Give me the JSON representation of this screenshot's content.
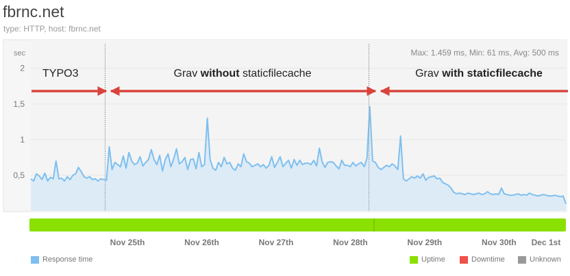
{
  "header": {
    "title": "fbrnc.net",
    "subtitle": "type: HTTP, host: fbrnc.net"
  },
  "stats": "Max: 1.459 ms, Min: 61 ms, Avg: 500 ms",
  "annotations": {
    "typo3": "TYPO3",
    "grav_prefix": "Grav ",
    "without_bold": "without",
    "without_suffix": " staticfilecache",
    "with_bold": "with staticfilecache"
  },
  "legend": {
    "response_time": "Response time",
    "uptime": "Uptime",
    "downtime": "Downtime",
    "unknown": "Unknown"
  },
  "colors": {
    "line": "#7dbfef",
    "area": "#ddebf7",
    "uptime": "#8ae000",
    "downtime": "#f0504a",
    "unknown": "#999999",
    "arrow": "#d9433b"
  },
  "chart_data": {
    "type": "area",
    "ylabel": "sec",
    "ylim": [
      0,
      2.4
    ],
    "yticks": [
      0.5,
      1,
      1.5,
      2
    ],
    "ytick_labels": [
      "0,5",
      "1",
      "1,5",
      "2"
    ],
    "xtick_labels": [
      "Nov 25th",
      "Nov 26th",
      "Nov 27th",
      "Nov 28th",
      "Nov 29th",
      "Nov 30th",
      "Dec 1st"
    ],
    "xlim_days": [
      24.0,
      31.2
    ],
    "xtick_days": [
      25.3,
      26.3,
      27.3,
      28.3,
      29.3,
      30.3,
      31.3
    ],
    "markers_days": [
      25.0,
      28.55
    ],
    "series": [
      {
        "name": "Response time",
        "values": [
          0.45,
          0.42,
          0.52,
          0.49,
          0.44,
          0.53,
          0.42,
          0.47,
          0.45,
          0.7,
          0.45,
          0.46,
          0.42,
          0.48,
          0.44,
          0.5,
          0.52,
          0.61,
          0.55,
          0.48,
          0.46,
          0.48,
          0.44,
          0.45,
          0.42,
          0.45,
          0.44,
          0.43,
          0.9,
          0.58,
          0.68,
          0.65,
          0.62,
          0.77,
          0.6,
          0.82,
          0.7,
          0.65,
          0.67,
          0.76,
          0.63,
          0.68,
          0.72,
          0.86,
          0.72,
          0.65,
          0.78,
          0.56,
          0.72,
          0.8,
          0.62,
          0.73,
          0.87,
          0.66,
          0.69,
          0.75,
          0.58,
          0.72,
          0.73,
          0.59,
          0.82,
          0.62,
          0.65,
          1.3,
          0.72,
          0.6,
          0.57,
          0.68,
          0.62,
          0.75,
          0.66,
          0.68,
          0.6,
          0.57,
          0.66,
          0.62,
          0.8,
          0.69,
          0.67,
          0.62,
          0.64,
          0.66,
          0.62,
          0.65,
          0.6,
          0.64,
          0.76,
          0.61,
          0.68,
          0.76,
          0.62,
          0.67,
          0.71,
          0.6,
          0.72,
          0.64,
          0.71,
          0.65,
          0.67,
          0.67,
          0.65,
          0.71,
          0.63,
          0.88,
          0.69,
          0.61,
          0.68,
          0.69,
          0.68,
          0.63,
          0.59,
          0.71,
          0.64,
          0.64,
          0.62,
          0.68,
          0.63,
          0.66,
          0.68,
          0.62,
          0.74,
          1.46,
          0.7,
          0.68,
          0.61,
          0.58,
          0.61,
          0.64,
          0.62,
          0.66,
          0.63,
          0.58,
          1.05,
          0.45,
          0.42,
          0.45,
          0.48,
          0.46,
          0.49,
          0.46,
          0.52,
          0.43,
          0.47,
          0.48,
          0.49,
          0.45,
          0.46,
          0.4,
          0.38,
          0.36,
          0.32,
          0.26,
          0.24,
          0.25,
          0.24,
          0.23,
          0.25,
          0.24,
          0.23,
          0.24,
          0.25,
          0.23,
          0.24,
          0.27,
          0.24,
          0.23,
          0.24,
          0.23,
          0.32,
          0.24,
          0.23,
          0.22,
          0.22,
          0.23,
          0.24,
          0.22,
          0.23,
          0.22,
          0.25,
          0.23,
          0.22,
          0.21,
          0.22,
          0.23,
          0.22,
          0.21,
          0.21,
          0.22,
          0.21,
          0.2,
          0.21,
          0.1
        ]
      }
    ]
  }
}
